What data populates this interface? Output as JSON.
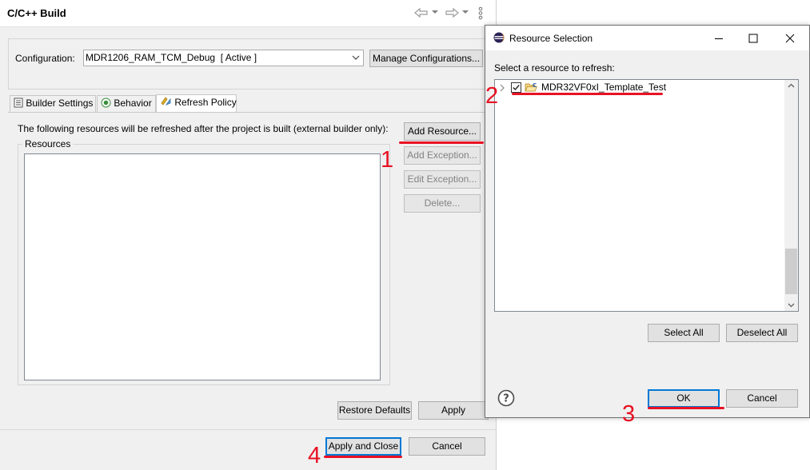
{
  "main": {
    "title": "C/C++ Build",
    "nav": {
      "back_icon": "arrow-left-icon",
      "forward_icon": "arrow-right-icon",
      "menu_icon": "vertical-ellipsis-icon"
    },
    "configuration_label": "Configuration:",
    "configuration_value": "MDR1206_RAM_TCM_Debug  [ Active ]",
    "manage_button": "Manage Configurations...",
    "tabs": [
      {
        "label": "Builder Settings",
        "icon": "builder-settings-icon"
      },
      {
        "label": "Behavior",
        "icon": "behavior-radio-icon"
      },
      {
        "label": "Refresh Policy",
        "icon": "refresh-policy-icon",
        "active": true
      }
    ],
    "refresh_description": "The following resources will be refreshed after the project is built (external builder only):",
    "resources_group_label": "Resources",
    "buttons": {
      "add_resource": "Add Resource...",
      "add_exception": "Add Exception...",
      "edit_exception": "Edit Exception...",
      "delete": "Delete...",
      "restore_defaults": "Restore Defaults",
      "apply": "Apply",
      "apply_and_close": "Apply and Close",
      "cancel": "Cancel"
    }
  },
  "dialog": {
    "title": "Resource Selection",
    "app_icon": "eclipse-icon",
    "window_controls": {
      "minimize": "minimize-icon",
      "maximize": "maximize-icon",
      "close": "close-icon"
    },
    "prompt": "Select a resource to refresh:",
    "tree_item": {
      "label": "MDR32VF0xI_Template_Test",
      "checked": true
    },
    "buttons": {
      "select_all": "Select All",
      "deselect_all": "Deselect All",
      "ok": "OK",
      "cancel": "Cancel"
    },
    "help_icon": "help-icon"
  },
  "annotations": {
    "step1": "1",
    "step2": "2",
    "step3": "3",
    "step4": "4",
    "color": "#e81123"
  }
}
